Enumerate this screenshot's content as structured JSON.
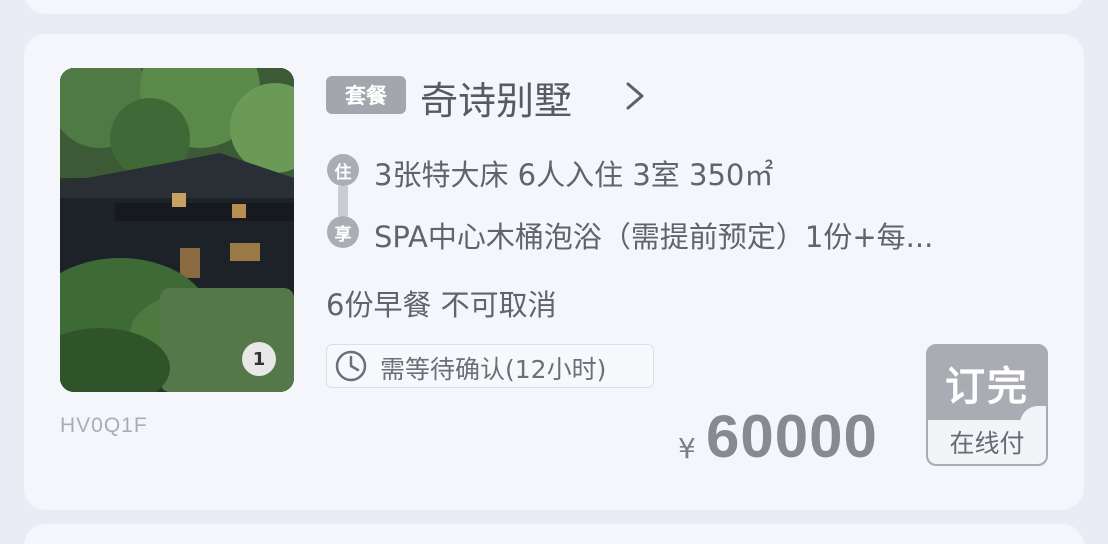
{
  "package": {
    "tag": "套餐",
    "title": "奇诗别墅",
    "photo_count": "1",
    "code": "HV0Q1F"
  },
  "details": {
    "room_icon_label": "住",
    "room": "3张特大床 6人入住 3室 350㎡",
    "perk_icon_label": "享",
    "perk": "SPA中心木桶泡浴（需提前预定）1份+每...",
    "meal_policy": "6份早餐  不可取消"
  },
  "confirm": {
    "text": "需等待确认(12小时)"
  },
  "pricing": {
    "currency": "¥",
    "amount": "60000"
  },
  "book_button": {
    "status": "订完",
    "payment": "在线付"
  },
  "colors": {
    "page_bg": "#e9ecf4",
    "card_bg": "#f5f6fb",
    "muted_gray": "#a9acb3",
    "text": "#5f646e"
  },
  "icons": {
    "chevron": "chevron-right-icon",
    "clock": "clock-icon"
  }
}
